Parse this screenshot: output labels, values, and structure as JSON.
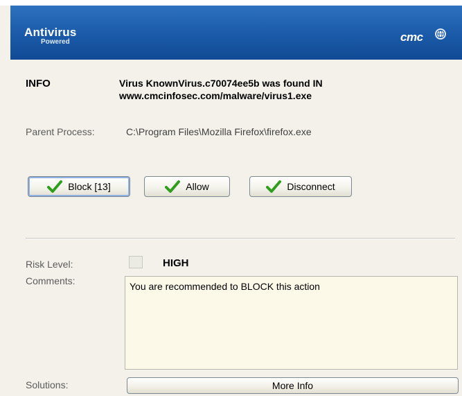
{
  "header": {
    "logo_title": "Antivirus",
    "logo_subtitle": "Powered",
    "brand": "cmc",
    "brand_icon": "globe-icon"
  },
  "info": {
    "label": "INFO",
    "message_line1": "Virus KnownVirus.c70074ee5b was found IN",
    "message_line2": "www.cmcinfosec.com/malware/virus1.exe"
  },
  "parent_process": {
    "label": "Parent Process:",
    "value": "C:\\Program Files\\Mozilla Firefox\\firefox.exe"
  },
  "actions": [
    {
      "label": "Block [13]",
      "icon": "check-icon",
      "focused": true
    },
    {
      "label": "Allow",
      "icon": "check-icon",
      "focused": false
    },
    {
      "label": "Disconnect",
      "icon": "check-icon",
      "focused": false
    }
  ],
  "risk": {
    "label": "Risk Level:",
    "value": "HIGH"
  },
  "comments": {
    "label": "Comments:",
    "text": "You are recommended to BLOCK this action"
  },
  "solutions": {
    "label": "Solutions:",
    "button_label": "More Info"
  },
  "colors": {
    "header": "#1a5aa8",
    "background": "#f3f1e9",
    "comments_bg": "#fcf9e9",
    "check": "#2e9e1c"
  }
}
